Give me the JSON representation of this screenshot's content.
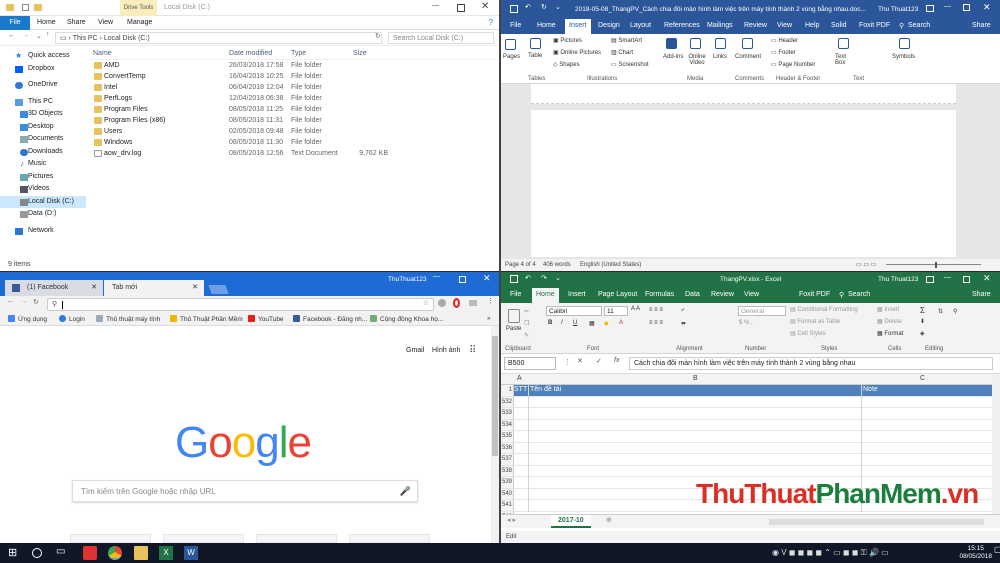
{
  "explorer": {
    "title": "Local Disk (C:)",
    "drive_tools": "Drive Tools",
    "ribbon_tabs": [
      "File",
      "Home",
      "Share",
      "View",
      "Manage"
    ],
    "address": [
      "This PC",
      "Local Disk (C:)"
    ],
    "search_placeholder": "Search Local Disk (C:)",
    "nav": [
      "Quick access",
      "Dropbox",
      "OneDrive",
      "This PC",
      "3D Objects",
      "Desktop",
      "Documents",
      "Downloads",
      "Music",
      "Pictures",
      "Videos",
      "Local Disk (C:)",
      "Data (D:)",
      "Network"
    ],
    "columns": [
      "Name",
      "Date modified",
      "Type",
      "Size"
    ],
    "files": [
      {
        "name": "AMD",
        "date": "26/03/2018 17:58",
        "type": "File folder",
        "size": ""
      },
      {
        "name": "ConvertTemp",
        "date": "16/04/2018 10:25",
        "type": "File folder",
        "size": ""
      },
      {
        "name": "Intel",
        "date": "06/04/2018 12:04",
        "type": "File folder",
        "size": ""
      },
      {
        "name": "PerfLogs",
        "date": "12/04/2018 06:38",
        "type": "File folder",
        "size": ""
      },
      {
        "name": "Program Files",
        "date": "08/05/2018 11:25",
        "type": "File folder",
        "size": ""
      },
      {
        "name": "Program Files (x86)",
        "date": "08/05/2018 11:31",
        "type": "File folder",
        "size": ""
      },
      {
        "name": "Users",
        "date": "02/05/2018 09:48",
        "type": "File folder",
        "size": ""
      },
      {
        "name": "Windows",
        "date": "08/05/2018 11:30",
        "type": "File folder",
        "size": ""
      },
      {
        "name": "aow_drv.log",
        "date": "08/05/2018 12:56",
        "type": "Text Document",
        "size": "9,762 KB"
      }
    ],
    "status": "9 items"
  },
  "word": {
    "title": "2018-05-08_ThangPV_Cách chia đôi màn hình làm việc trên máy tính thành 2 vùng bằng nhau.doc...",
    "user": "Thu Thuat123",
    "tabs": [
      "File",
      "Home",
      "Insert",
      "Design",
      "Layout",
      "References",
      "Mailings",
      "Review",
      "View",
      "Help",
      "Solid",
      "Foxit PDF"
    ],
    "search_label": "Search",
    "share_label": "Share",
    "ribbon": {
      "pages": "Pages",
      "table": "Table",
      "pictures": "Pictures",
      "online_pictures": "Online Pictures",
      "shapes": "Shapes",
      "smartart": "SmartArt",
      "chart": "Chart",
      "screenshot": "Screenshot",
      "addins": "Add-ins",
      "online_video": "Online Video",
      "links": "Links",
      "comment": "Comment",
      "header": "Header",
      "footer": "Footer",
      "page_number": "Page Number",
      "text_box": "Text Box",
      "symbols": "Symbols"
    },
    "groups": [
      "Tables",
      "Illustrations",
      "Media",
      "Comments",
      "Header & Footer",
      "Text"
    ],
    "status": {
      "page": "Page 4 of 4",
      "words": "406 words",
      "language": "English (United States)"
    }
  },
  "chrome": {
    "user": "ThuThuat123",
    "tabs": [
      "(1) Facebook",
      "Tab mới"
    ],
    "bookmarks": [
      "Ứng dụng",
      "Login",
      "Thủ thuật máy tính",
      "Thủ Thuật Phần Mềm",
      "YouTube",
      "Facebook - Đăng nh...",
      "Cộng đồng Khoa họ..."
    ],
    "links": [
      "Gmail",
      "Hình ảnh"
    ],
    "search_placeholder": "Tìm kiếm trên Google hoặc nhập URL",
    "logo_letters": [
      "G",
      "o",
      "o",
      "g",
      "l",
      "e"
    ],
    "logo_colors": [
      "#4285f4",
      "#ea4335",
      "#fbbc05",
      "#4285f4",
      "#34a853",
      "#ea4335"
    ]
  },
  "excel": {
    "title": "ThangPV.xlsx - Excel",
    "user": "Thu Thuat123",
    "tabs": [
      "File",
      "Home",
      "Insert",
      "Page Layout",
      "Formulas",
      "Data",
      "Review",
      "View",
      "Foxit PDF"
    ],
    "search_label": "Search",
    "share_label": "Share",
    "font": "Calibri",
    "font_size": "11",
    "number_format": "General",
    "styles": [
      "Conditional Formatting",
      "Format as Table",
      "Cell Styles"
    ],
    "cells_btns": [
      "Insert",
      "Delete",
      "Format"
    ],
    "groups": [
      "Clipboard",
      "Font",
      "Alignment",
      "Number",
      "Styles",
      "Cells",
      "Editing"
    ],
    "paste": "Paste",
    "namebox": "B500",
    "formula": "Cách chia đôi màn hình làm việc trên máy tính thành 2 vùng bằng nhau",
    "columns": [
      "A",
      "B",
      "C"
    ],
    "header_row": {
      "num": "1",
      "a": "STT",
      "b": "Tên đề tài",
      "c": "Note"
    },
    "rows": [
      "532",
      "533",
      "534",
      "535",
      "536",
      "537",
      "538",
      "539",
      "540",
      "541",
      "542"
    ],
    "sheet": "2017-10",
    "status": "Edit"
  },
  "watermark": {
    "part1": "ThuThuat",
    "part2": "PhanMem",
    "part3": ".vn"
  },
  "taskbar": {
    "time": "15:15",
    "date": "08/05/2018"
  }
}
